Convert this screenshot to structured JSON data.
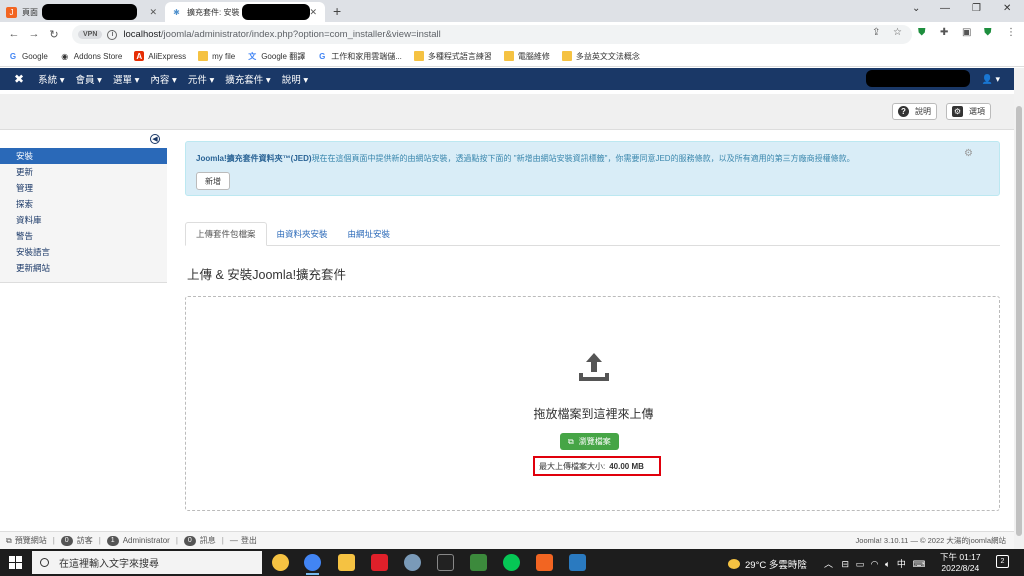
{
  "browser": {
    "tabs": [
      {
        "title": "頁面",
        "active": false
      },
      {
        "title": "擴充套件: 安裝",
        "active": true
      }
    ],
    "url_host": "localhost",
    "url_path": "/joomla/administrator/index.php?option=com_installer&view=install",
    "vpn_label": "VPN",
    "bookmarks": [
      "Google",
      "Addons Store",
      "AliExpress",
      "my file",
      "Google 翻譯",
      "工作和家用雲端儲...",
      "多種程式語言練習",
      "電腦維修",
      "多益英文文法概念"
    ]
  },
  "joomla_nav": {
    "menus": [
      "系統",
      "會員",
      "選單",
      "內容",
      "元件",
      "擴充套件",
      "說明"
    ]
  },
  "toolbar": {
    "help_label": "說明",
    "options_label": "選項"
  },
  "sidebar": {
    "items": [
      {
        "label": "安裝",
        "active": true
      },
      {
        "label": "更新",
        "active": false
      },
      {
        "label": "管理",
        "active": false
      },
      {
        "label": "探索",
        "active": false
      },
      {
        "label": "資料庫",
        "active": false
      },
      {
        "label": "警告",
        "active": false
      },
      {
        "label": "安裝語言",
        "active": false
      },
      {
        "label": "更新網站",
        "active": false
      }
    ]
  },
  "alert": {
    "bold_text": "Joomla!擴充套件資料夾™(JED)",
    "text": "現在在這個頁面中提供新的由網站安裝，透過點按下面的 \"新增由網站安裝資訊標籤\"，你需要同意JED的服務條款，以及所有適用的第三方廠商授權條款。",
    "button_label": "新增"
  },
  "page_tabs": [
    {
      "label": "上傳套件包檔案",
      "active": true
    },
    {
      "label": "由資料夾安裝",
      "active": false
    },
    {
      "label": "由網址安裝",
      "active": false
    }
  ],
  "section_title": "上傳 & 安裝Joomla!擴充套件",
  "dropzone": {
    "drop_text": "拖放檔案到這裡來上傳",
    "browse_label": "瀏覽檔案",
    "max_size_label": "最大上傳檔案大小:",
    "max_size_value": "40.00 MB"
  },
  "statusbar": {
    "preview_label": "預覽網站",
    "visitors_count": "0",
    "visitors_label": "訪客",
    "admin_count": "1",
    "admin_label": "Administrator",
    "messages_count": "0",
    "messages_label": "訊息",
    "logout_label": "登出",
    "footer": "Joomla! 3.10.11 — © 2022 大湯的joomla網站"
  },
  "taskbar": {
    "search_placeholder": "在這裡輸入文字來搜尋",
    "weather": "29°C  多雲時陰",
    "ime": "中",
    "time": "下午 01:17",
    "date": "2022/8/24",
    "notif_count": "2"
  },
  "colors": {
    "joomla_nav": "#1a3867",
    "active_sidebar": "#2a69b8",
    "browse_button": "#46a546",
    "highlight": "#e0000c"
  }
}
